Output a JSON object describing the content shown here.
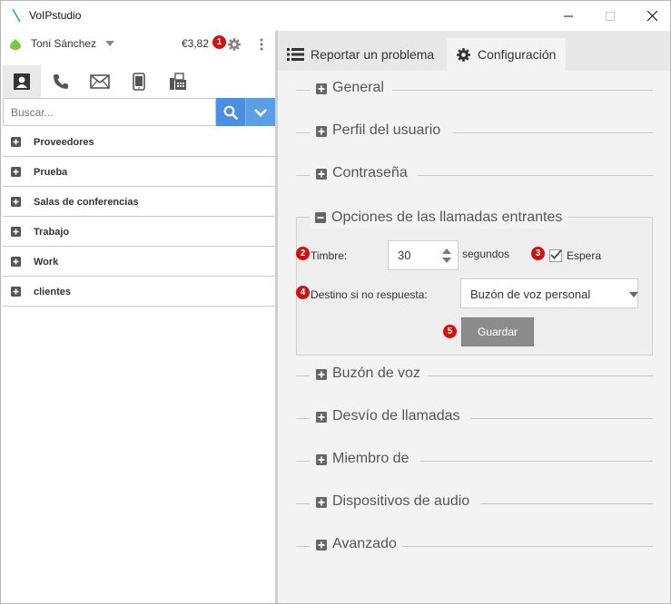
{
  "window": {
    "title": "VoIPstudio"
  },
  "user_bar": {
    "name": "Toni Sánchez",
    "balance": "€3,82"
  },
  "callouts": [
    "1",
    "2",
    "3",
    "4",
    "5"
  ],
  "left_tabs": [
    {
      "name": "contacts",
      "icon": "contact-card-icon",
      "active": true
    },
    {
      "name": "calls",
      "icon": "phone-icon",
      "active": false
    },
    {
      "name": "messages",
      "icon": "envelope-icon",
      "active": false
    },
    {
      "name": "mobile",
      "icon": "mobile-phone-icon",
      "active": false
    },
    {
      "name": "fax",
      "icon": "fax-icon",
      "active": false
    }
  ],
  "search": {
    "placeholder": "Buscar..."
  },
  "groups": [
    "Proveedores",
    "Prueba",
    "Salas de conferencias",
    "Trabajo",
    "Work",
    "clientes"
  ],
  "right_tabs": {
    "report": "Reportar un problema",
    "config": "Configuración"
  },
  "sections": {
    "general": "General",
    "profile": "Perfil del usuario",
    "password": "Contraseña",
    "incoming": "Opciones de las llamadas entrantes",
    "voicemail": "Buzón de voz",
    "forwarding": "Desvío de llamadas",
    "member_of": "Miembro de",
    "audio_devices": "Dispositivos de audio",
    "advanced": "Avanzado"
  },
  "incoming_options": {
    "ring_label": "Timbre:",
    "ring_value": "30",
    "ring_unit": "segundos",
    "wait_label": "Espera",
    "wait_checked": true,
    "no_answer_label": "Destino si no respuesta:",
    "no_answer_value": "Buzón de voz personal",
    "save_label": "Guardar"
  },
  "colors": {
    "accent_blue": "#4a90e2",
    "status_green": "#7ac943",
    "callout_red": "#d21010",
    "save_gray": "#8c8c8c"
  }
}
